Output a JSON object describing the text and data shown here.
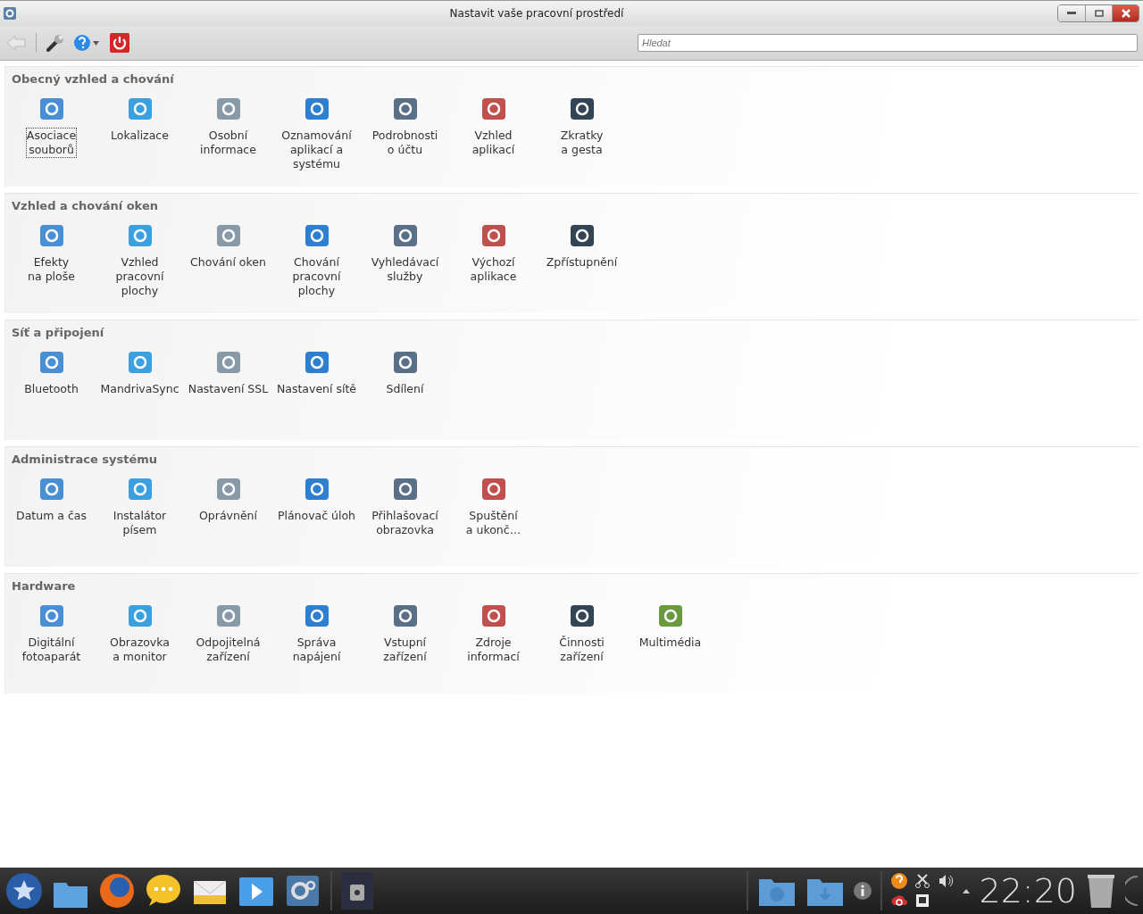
{
  "window": {
    "title": "Nastavit vaše pracovní prostředí"
  },
  "search": {
    "placeholder": "Hledat"
  },
  "sections": [
    {
      "title": "Obecný vzhled a chování",
      "items": [
        {
          "label": "Asociace\nsouborů",
          "selected": true
        },
        {
          "label": "Lokalizace",
          "selected": false
        },
        {
          "label": "Osobní\ninformace",
          "selected": false
        },
        {
          "label": "Oznamování\naplikací a\nsystému",
          "selected": false
        },
        {
          "label": "Podrobnosti\no účtu",
          "selected": false
        },
        {
          "label": "Vzhled\naplikací",
          "selected": false
        },
        {
          "label": "Zkratky\na gesta",
          "selected": false
        }
      ]
    },
    {
      "title": "Vzhled a chování oken",
      "items": [
        {
          "label": "Efekty\nna ploše",
          "selected": false
        },
        {
          "label": "Vzhled\npracovní\nplochy",
          "selected": false
        },
        {
          "label": "Chování oken",
          "selected": false
        },
        {
          "label": "Chování\npracovní\nplochy",
          "selected": false
        },
        {
          "label": "Vyhledávací\nslužby",
          "selected": false
        },
        {
          "label": "Výchozí\naplikace",
          "selected": false
        },
        {
          "label": "Zpřístupnění",
          "selected": false
        }
      ]
    },
    {
      "title": "Síť a připojení",
      "items": [
        {
          "label": "Bluetooth",
          "selected": false
        },
        {
          "label": "MandrivaSync",
          "selected": false
        },
        {
          "label": "Nastavení SSL",
          "selected": false
        },
        {
          "label": "Nastavení sítě",
          "selected": false
        },
        {
          "label": "Sdílení",
          "selected": false
        }
      ]
    },
    {
      "title": "Administrace systému",
      "items": [
        {
          "label": "Datum a čas",
          "selected": false
        },
        {
          "label": "Instalátor\npísem",
          "selected": false
        },
        {
          "label": "Oprávnění",
          "selected": false
        },
        {
          "label": "Plánovač úloh",
          "selected": false
        },
        {
          "label": "Přihlašovací\nobrazovka",
          "selected": false
        },
        {
          "label": "Spuštění\na ukonč…",
          "selected": false
        }
      ]
    },
    {
      "title": "Hardware",
      "items": [
        {
          "label": "Digitální\nfotoaparát",
          "selected": false
        },
        {
          "label": "Obrazovka\na monitor",
          "selected": false
        },
        {
          "label": "Odpojitelná\nzařízení",
          "selected": false
        },
        {
          "label": "Správa\nnapájení",
          "selected": false
        },
        {
          "label": "Vstupní\nzařízení",
          "selected": false
        },
        {
          "label": "Zdroje\ninformací",
          "selected": false
        },
        {
          "label": "Činnosti\nzařízení",
          "selected": false
        },
        {
          "label": "Multimédia",
          "selected": false
        }
      ]
    }
  ],
  "taskbar": {
    "clock": "22:20"
  }
}
